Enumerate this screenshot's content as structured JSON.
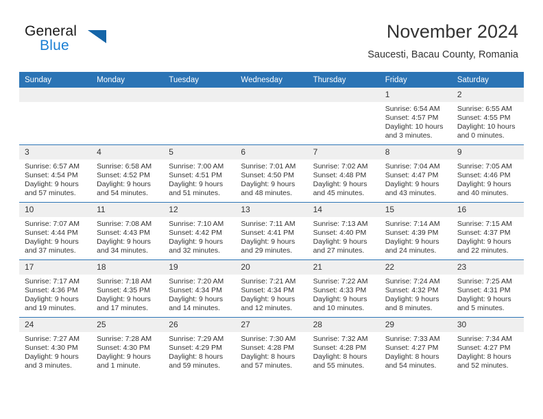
{
  "brand": {
    "name_part1": "General",
    "name_part2": "Blue",
    "logo_icon": "triangle-flag-icon",
    "color_blue": "#1a7fd4",
    "color_triangle": "#1565a8"
  },
  "header": {
    "title": "November 2024",
    "subtitle": "Saucesti, Bacau County, Romania",
    "accent_color": "#2b74b5"
  },
  "weekday_headers": [
    "Sunday",
    "Monday",
    "Tuesday",
    "Wednesday",
    "Thursday",
    "Friday",
    "Saturday"
  ],
  "weeks": [
    [
      {
        "day": "",
        "lines": [
          "",
          "",
          "",
          ""
        ],
        "empty": true
      },
      {
        "day": "",
        "lines": [
          "",
          "",
          "",
          ""
        ],
        "empty": true
      },
      {
        "day": "",
        "lines": [
          "",
          "",
          "",
          ""
        ],
        "empty": true
      },
      {
        "day": "",
        "lines": [
          "",
          "",
          "",
          ""
        ],
        "empty": true
      },
      {
        "day": "",
        "lines": [
          "",
          "",
          "",
          ""
        ],
        "empty": true
      },
      {
        "day": "1",
        "lines": [
          "Sunrise: 6:54 AM",
          "Sunset: 4:57 PM",
          "Daylight: 10 hours",
          "and 3 minutes."
        ],
        "empty": false
      },
      {
        "day": "2",
        "lines": [
          "Sunrise: 6:55 AM",
          "Sunset: 4:55 PM",
          "Daylight: 10 hours",
          "and 0 minutes."
        ],
        "empty": false
      }
    ],
    [
      {
        "day": "3",
        "lines": [
          "Sunrise: 6:57 AM",
          "Sunset: 4:54 PM",
          "Daylight: 9 hours",
          "and 57 minutes."
        ],
        "empty": false
      },
      {
        "day": "4",
        "lines": [
          "Sunrise: 6:58 AM",
          "Sunset: 4:52 PM",
          "Daylight: 9 hours",
          "and 54 minutes."
        ],
        "empty": false
      },
      {
        "day": "5",
        "lines": [
          "Sunrise: 7:00 AM",
          "Sunset: 4:51 PM",
          "Daylight: 9 hours",
          "and 51 minutes."
        ],
        "empty": false
      },
      {
        "day": "6",
        "lines": [
          "Sunrise: 7:01 AM",
          "Sunset: 4:50 PM",
          "Daylight: 9 hours",
          "and 48 minutes."
        ],
        "empty": false
      },
      {
        "day": "7",
        "lines": [
          "Sunrise: 7:02 AM",
          "Sunset: 4:48 PM",
          "Daylight: 9 hours",
          "and 45 minutes."
        ],
        "empty": false
      },
      {
        "day": "8",
        "lines": [
          "Sunrise: 7:04 AM",
          "Sunset: 4:47 PM",
          "Daylight: 9 hours",
          "and 43 minutes."
        ],
        "empty": false
      },
      {
        "day": "9",
        "lines": [
          "Sunrise: 7:05 AM",
          "Sunset: 4:46 PM",
          "Daylight: 9 hours",
          "and 40 minutes."
        ],
        "empty": false
      }
    ],
    [
      {
        "day": "10",
        "lines": [
          "Sunrise: 7:07 AM",
          "Sunset: 4:44 PM",
          "Daylight: 9 hours",
          "and 37 minutes."
        ],
        "empty": false
      },
      {
        "day": "11",
        "lines": [
          "Sunrise: 7:08 AM",
          "Sunset: 4:43 PM",
          "Daylight: 9 hours",
          "and 34 minutes."
        ],
        "empty": false
      },
      {
        "day": "12",
        "lines": [
          "Sunrise: 7:10 AM",
          "Sunset: 4:42 PM",
          "Daylight: 9 hours",
          "and 32 minutes."
        ],
        "empty": false
      },
      {
        "day": "13",
        "lines": [
          "Sunrise: 7:11 AM",
          "Sunset: 4:41 PM",
          "Daylight: 9 hours",
          "and 29 minutes."
        ],
        "empty": false
      },
      {
        "day": "14",
        "lines": [
          "Sunrise: 7:13 AM",
          "Sunset: 4:40 PM",
          "Daylight: 9 hours",
          "and 27 minutes."
        ],
        "empty": false
      },
      {
        "day": "15",
        "lines": [
          "Sunrise: 7:14 AM",
          "Sunset: 4:39 PM",
          "Daylight: 9 hours",
          "and 24 minutes."
        ],
        "empty": false
      },
      {
        "day": "16",
        "lines": [
          "Sunrise: 7:15 AM",
          "Sunset: 4:37 PM",
          "Daylight: 9 hours",
          "and 22 minutes."
        ],
        "empty": false
      }
    ],
    [
      {
        "day": "17",
        "lines": [
          "Sunrise: 7:17 AM",
          "Sunset: 4:36 PM",
          "Daylight: 9 hours",
          "and 19 minutes."
        ],
        "empty": false
      },
      {
        "day": "18",
        "lines": [
          "Sunrise: 7:18 AM",
          "Sunset: 4:35 PM",
          "Daylight: 9 hours",
          "and 17 minutes."
        ],
        "empty": false
      },
      {
        "day": "19",
        "lines": [
          "Sunrise: 7:20 AM",
          "Sunset: 4:34 PM",
          "Daylight: 9 hours",
          "and 14 minutes."
        ],
        "empty": false
      },
      {
        "day": "20",
        "lines": [
          "Sunrise: 7:21 AM",
          "Sunset: 4:34 PM",
          "Daylight: 9 hours",
          "and 12 minutes."
        ],
        "empty": false
      },
      {
        "day": "21",
        "lines": [
          "Sunrise: 7:22 AM",
          "Sunset: 4:33 PM",
          "Daylight: 9 hours",
          "and 10 minutes."
        ],
        "empty": false
      },
      {
        "day": "22",
        "lines": [
          "Sunrise: 7:24 AM",
          "Sunset: 4:32 PM",
          "Daylight: 9 hours",
          "and 8 minutes."
        ],
        "empty": false
      },
      {
        "day": "23",
        "lines": [
          "Sunrise: 7:25 AM",
          "Sunset: 4:31 PM",
          "Daylight: 9 hours",
          "and 5 minutes."
        ],
        "empty": false
      }
    ],
    [
      {
        "day": "24",
        "lines": [
          "Sunrise: 7:27 AM",
          "Sunset: 4:30 PM",
          "Daylight: 9 hours",
          "and 3 minutes."
        ],
        "empty": false
      },
      {
        "day": "25",
        "lines": [
          "Sunrise: 7:28 AM",
          "Sunset: 4:30 PM",
          "Daylight: 9 hours",
          "and 1 minute."
        ],
        "empty": false
      },
      {
        "day": "26",
        "lines": [
          "Sunrise: 7:29 AM",
          "Sunset: 4:29 PM",
          "Daylight: 8 hours",
          "and 59 minutes."
        ],
        "empty": false
      },
      {
        "day": "27",
        "lines": [
          "Sunrise: 7:30 AM",
          "Sunset: 4:28 PM",
          "Daylight: 8 hours",
          "and 57 minutes."
        ],
        "empty": false
      },
      {
        "day": "28",
        "lines": [
          "Sunrise: 7:32 AM",
          "Sunset: 4:28 PM",
          "Daylight: 8 hours",
          "and 55 minutes."
        ],
        "empty": false
      },
      {
        "day": "29",
        "lines": [
          "Sunrise: 7:33 AM",
          "Sunset: 4:27 PM",
          "Daylight: 8 hours",
          "and 54 minutes."
        ],
        "empty": false
      },
      {
        "day": "30",
        "lines": [
          "Sunrise: 7:34 AM",
          "Sunset: 4:27 PM",
          "Daylight: 8 hours",
          "and 52 minutes."
        ],
        "empty": false
      }
    ]
  ]
}
